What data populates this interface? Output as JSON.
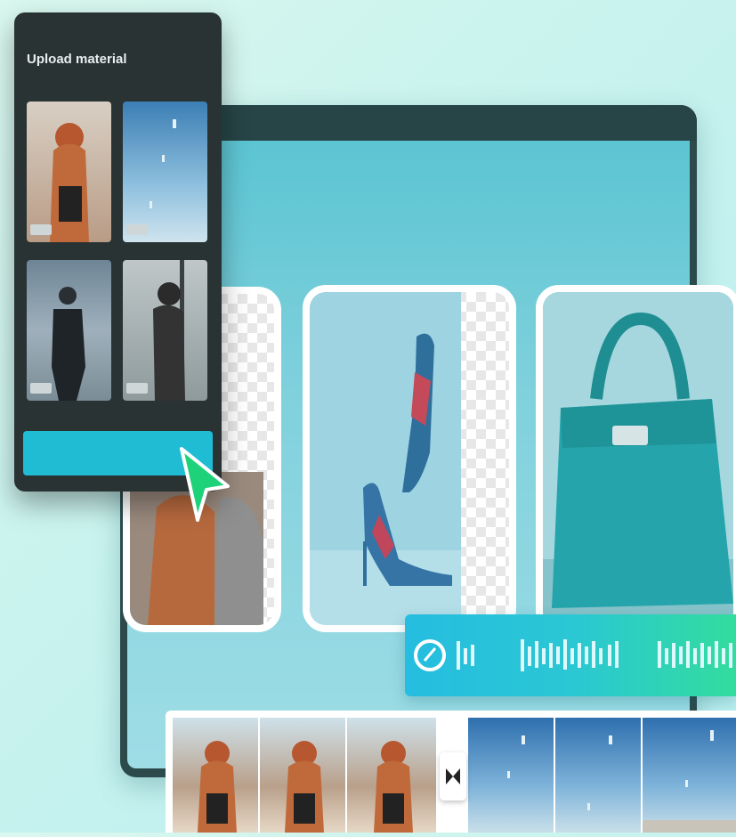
{
  "upload_panel": {
    "title": "Upload material",
    "button_label": "",
    "thumbnails": [
      {
        "name": "thumb-woman-red-hair"
      },
      {
        "name": "thumb-sky-scene"
      },
      {
        "name": "thumb-man-street"
      },
      {
        "name": "thumb-woman-pole"
      }
    ]
  },
  "icons": {
    "cursor": "cursor-arrow-icon",
    "audio": "audio-track-icon",
    "transition": "transition-icon"
  },
  "colors": {
    "accent": "#20bcd4",
    "cursor": "#1ed27a",
    "audio_start": "#26bde0",
    "audio_end": "#33dc9e",
    "panel_bg": "#2a3334",
    "canvas": "#6cc9d6"
  }
}
